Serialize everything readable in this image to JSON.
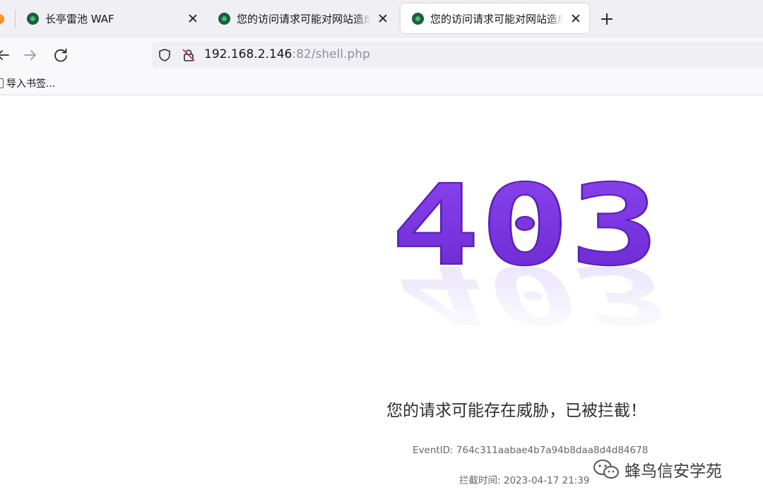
{
  "browser": {
    "tabs": [
      {
        "title": "长亭雷池 WAF",
        "active": false
      },
      {
        "title": "您的访问请求可能对网站造成安全威胁",
        "active": false
      },
      {
        "title": "您的访问请求可能对网站造成安全威胁",
        "active": true
      }
    ],
    "url": {
      "host": "192.168.2.146",
      "rest": ":82/shell.php"
    },
    "bookmarks": {
      "import_label": "导入书签..."
    }
  },
  "page": {
    "status_code": "403",
    "accent_color": "#7432dd",
    "message": "您的请求可能存在威胁，已被拦截！",
    "event_id_label": "EventID:",
    "event_id": "764c311aabae4b7a94b8daa8d4d84678",
    "block_time_label": "拦截时间:",
    "block_time": "2023-04-17 21:39"
  },
  "watermark": {
    "text": "蜂鸟信安学苑"
  }
}
